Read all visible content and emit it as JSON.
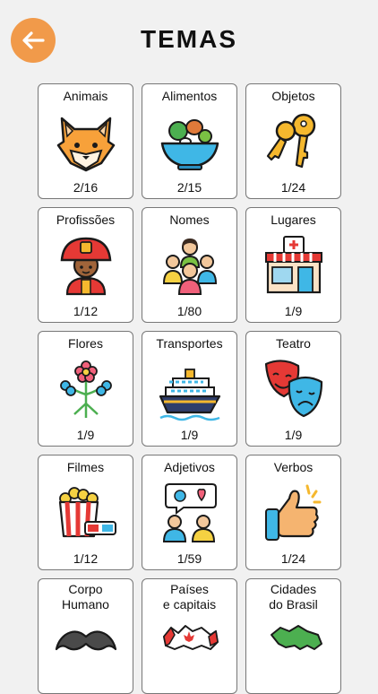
{
  "header": {
    "title": "TEMAS",
    "back_icon": "arrow-left-icon",
    "accent": "#f19a4a"
  },
  "topics": [
    {
      "label": "Animais",
      "progress": "2/16",
      "icon": "fox-icon"
    },
    {
      "label": "Alimentos",
      "progress": "2/15",
      "icon": "salad-bowl-icon"
    },
    {
      "label": "Objetos",
      "progress": "1/24",
      "icon": "keys-icon"
    },
    {
      "label": "Profissões",
      "progress": "1/12",
      "icon": "firefighter-icon"
    },
    {
      "label": "Nomes",
      "progress": "1/80",
      "icon": "people-group-icon"
    },
    {
      "label": "Lugares",
      "progress": "1/9",
      "icon": "pharmacy-building-icon"
    },
    {
      "label": "Flores",
      "progress": "1/9",
      "icon": "flowers-icon"
    },
    {
      "label": "Transportes",
      "progress": "1/9",
      "icon": "cruise-ship-icon"
    },
    {
      "label": "Teatro",
      "progress": "1/9",
      "icon": "theater-masks-icon"
    },
    {
      "label": "Filmes",
      "progress": "1/12",
      "icon": "popcorn-3d-glasses-icon"
    },
    {
      "label": "Adjetivos",
      "progress": "1/59",
      "icon": "chat-people-icon"
    },
    {
      "label": "Verbos",
      "progress": "1/24",
      "icon": "thumbs-up-icon"
    },
    {
      "label": "Corpo\nHumano",
      "progress": "",
      "icon": "mustache-icon"
    },
    {
      "label": "Países\ne capitais",
      "progress": "",
      "icon": "canada-map-icon"
    },
    {
      "label": "Cidades\ndo Brasil",
      "progress": "",
      "icon": "brazil-map-icon"
    }
  ]
}
